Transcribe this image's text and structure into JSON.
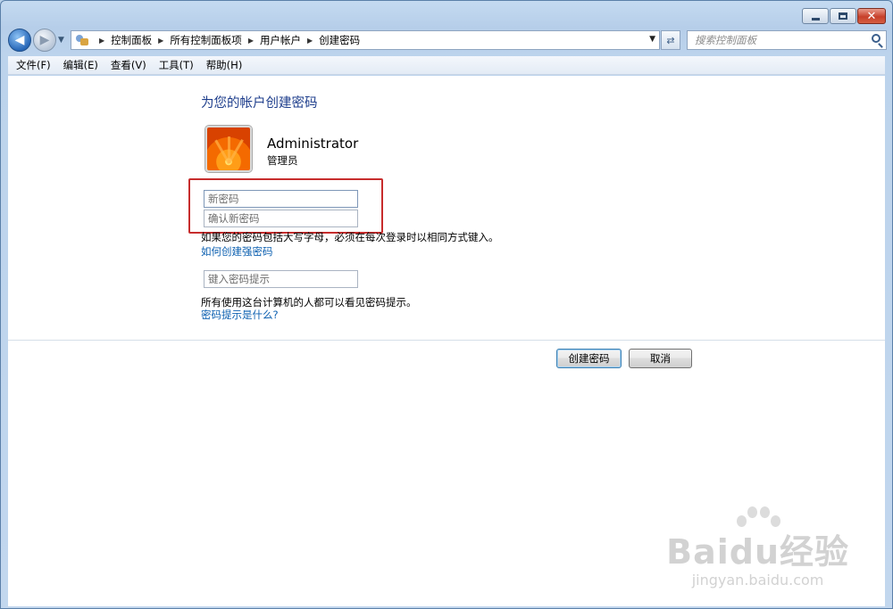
{
  "window": {
    "caption_buttons": {
      "minimize": "minimize-icon",
      "maximize": "maximize-icon",
      "close": "close-icon"
    }
  },
  "navigation": {
    "back_icon": "back-arrow-icon",
    "forward_icon": "forward-arrow-icon",
    "breadcrumb": [
      "控制面板",
      "所有控制面板项",
      "用户帐户",
      "创建密码"
    ],
    "search_placeholder": "搜索控制面板"
  },
  "menu": [
    "文件(F)",
    "编辑(E)",
    "查看(V)",
    "工具(T)",
    "帮助(H)"
  ],
  "page": {
    "title": "为您的帐户创建密码",
    "user": {
      "name": "Administrator",
      "role": "管理员"
    },
    "new_password_placeholder": "新密码",
    "confirm_password_placeholder": "确认新密码",
    "case_note": "如果您的密码包括大写字母，必须在每次登录时以相同方式键入。",
    "strong_password_link": "如何创建强密码",
    "hint_placeholder": "键入密码提示",
    "hint_note": "所有使用这台计算机的人都可以看见密码提示。",
    "hint_link": "密码提示是什么?",
    "create_button": "创建密码",
    "cancel_button": "取消"
  },
  "watermark": {
    "main": "Baidu经验",
    "sub": "jingyan.baidu.com"
  },
  "colors": {
    "heading": "#1e3e8c",
    "link": "#0b5fb0",
    "highlight_box": "#c72d2d"
  }
}
